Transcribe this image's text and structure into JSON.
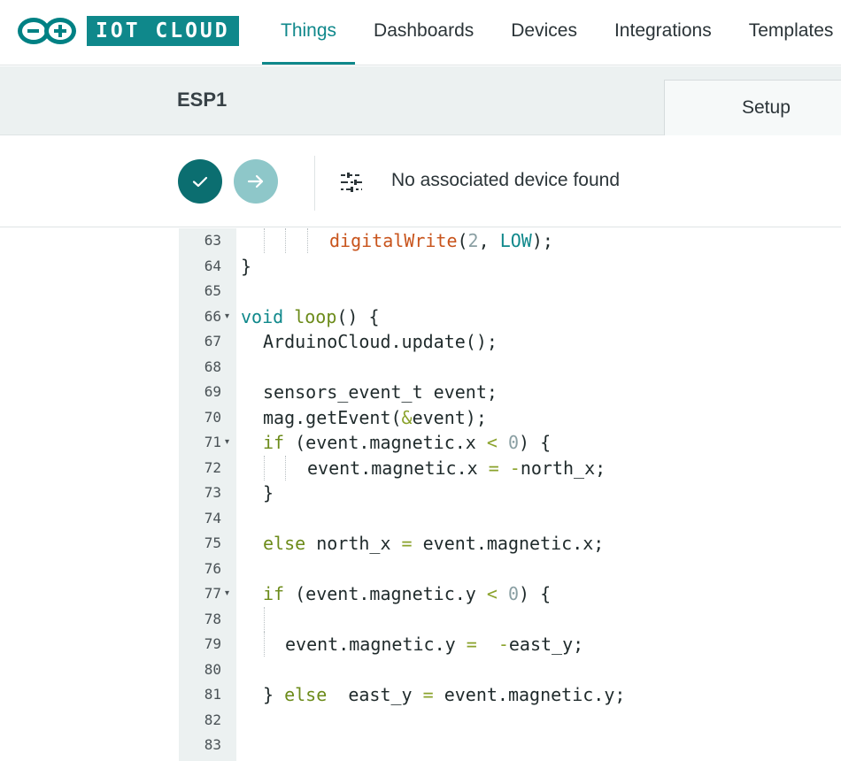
{
  "brand": {
    "logo_text": "IOT CLOUD",
    "accent": "#008184"
  },
  "nav": {
    "items": [
      {
        "label": "Things",
        "active": true
      },
      {
        "label": "Dashboards",
        "active": false
      },
      {
        "label": "Devices",
        "active": false
      },
      {
        "label": "Integrations",
        "active": false
      },
      {
        "label": "Templates",
        "active": false
      }
    ]
  },
  "thing": {
    "title": "ESP1",
    "setup_tab": "Setup"
  },
  "toolbar": {
    "verify_icon": "check-icon",
    "upload_icon": "arrow-right-icon",
    "device_icon": "sliders-icon",
    "device_status": "No associated device found"
  },
  "editor": {
    "lines": [
      {
        "n": "63",
        "fold": ""
      },
      {
        "n": "64",
        "fold": ""
      },
      {
        "n": "65",
        "fold": ""
      },
      {
        "n": "66",
        "fold": "▾"
      },
      {
        "n": "67",
        "fold": ""
      },
      {
        "n": "68",
        "fold": ""
      },
      {
        "n": "69",
        "fold": ""
      },
      {
        "n": "70",
        "fold": ""
      },
      {
        "n": "71",
        "fold": "▾"
      },
      {
        "n": "72",
        "fold": ""
      },
      {
        "n": "73",
        "fold": ""
      },
      {
        "n": "74",
        "fold": ""
      },
      {
        "n": "75",
        "fold": ""
      },
      {
        "n": "76",
        "fold": ""
      },
      {
        "n": "77",
        "fold": "▾"
      },
      {
        "n": "78",
        "fold": ""
      },
      {
        "n": "79",
        "fold": ""
      },
      {
        "n": "80",
        "fold": ""
      },
      {
        "n": "81",
        "fold": ""
      },
      {
        "n": "82",
        "fold": ""
      },
      {
        "n": "83",
        "fold": ""
      }
    ],
    "code": {
      "l63_fn": "digitalWrite",
      "l63_open": "(",
      "l63_num": "2",
      "l63_sep": ", ",
      "l63_const": "LOW",
      "l63_close": ");",
      "l64": "}",
      "l66_void": "void",
      "l66_loop": "loop",
      "l66_rest": "() {",
      "l67": "ArduinoCloud.update();",
      "l69": "sensors_event_t event;",
      "l70_a": "mag.getEvent(",
      "l70_amp": "&",
      "l70_b": "event);",
      "l71_if": "if",
      "l71_a": " (event.magnetic.x ",
      "l71_lt": "<",
      "l71_sp": " ",
      "l71_num": "0",
      "l71_b": ") {",
      "l72_a": "event.magnetic.x ",
      "l72_eq": "=",
      "l72_sp": " ",
      "l72_neg": "-",
      "l72_b": "north_x;",
      "l73": "}",
      "l75_else": "else",
      "l75_a": " north_x ",
      "l75_eq": "=",
      "l75_b": " event.magnetic.x;",
      "l77_if": "if",
      "l77_a": " (event.magnetic.y ",
      "l77_lt": "<",
      "l77_sp": " ",
      "l77_num": "0",
      "l77_b": ") {",
      "l79_a": "event.magnetic.y ",
      "l79_eq": "=",
      "l79_sp": "  ",
      "l79_neg": "-",
      "l79_b": "east_y;",
      "l81_a": "} ",
      "l81_else": "else",
      "l81_b": "  east_y ",
      "l81_eq": "=",
      "l81_c": " event.magnetic.y;"
    }
  }
}
